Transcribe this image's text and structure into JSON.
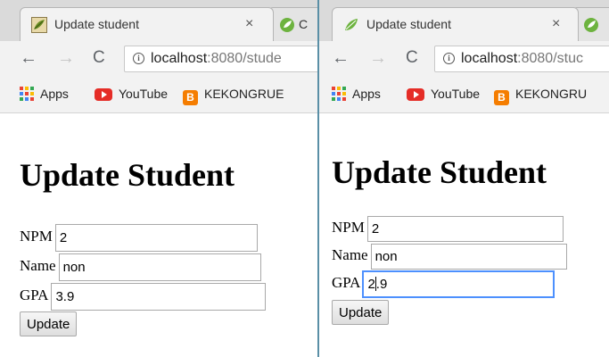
{
  "colors": {
    "accent_focus": "#4d90fe",
    "divider": "#5a8fa6",
    "youtube": "#e52d27",
    "blogger": "#f57d00"
  },
  "left": {
    "tab_active": {
      "title": "Update student",
      "close": "×",
      "icon": "leaf-tile-icon"
    },
    "tab_next": {
      "title": "C",
      "icon": "spring-icon"
    },
    "address": {
      "host": "localhost",
      "rest": ":8080/stude"
    },
    "bookmarks": [
      "Apps",
      "YouTube",
      "KEKONGRUE"
    ],
    "page": {
      "heading": "Update Student",
      "npm": {
        "label": "NPM",
        "value": "2"
      },
      "name": {
        "label": "Name",
        "value": "non"
      },
      "gpa": {
        "label": "GPA",
        "value": "3.9"
      },
      "button": "Update"
    }
  },
  "right": {
    "tab_active": {
      "title": "Update student",
      "close": "×",
      "icon": "spring-icon"
    },
    "tab_next": {
      "title": "",
      "icon": "spring-icon"
    },
    "address": {
      "host": "localhost",
      "rest": ":8080/stuc"
    },
    "bookmarks": [
      "Apps",
      "YouTube",
      "KEKONGRU"
    ],
    "page": {
      "heading": "Update Student",
      "npm": {
        "label": "NPM",
        "value": "2"
      },
      "name": {
        "label": "Name",
        "value": "non"
      },
      "gpa": {
        "label": "GPA",
        "value_before_caret": "2",
        "value_after_caret": ".9"
      },
      "button": "Update"
    }
  }
}
